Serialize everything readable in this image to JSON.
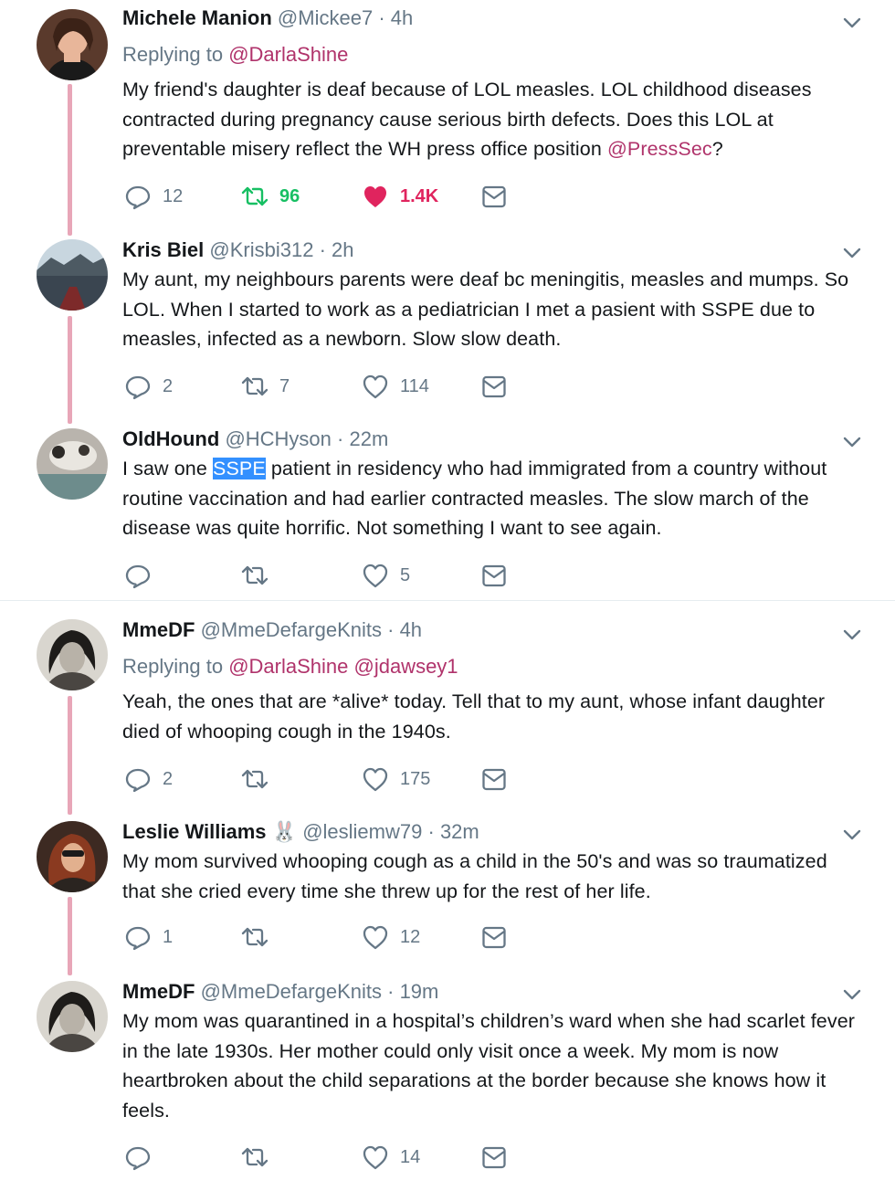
{
  "colors": {
    "mention": "#b0336b",
    "thread_line": "#e8a6b8",
    "retweet_active": "#17bf63",
    "like_active": "#e0245e",
    "secondary": "#657786"
  },
  "threads": [
    {
      "tweets": [
        {
          "name": "Michele Manion",
          "handle": "@Mickee7",
          "time": "4h",
          "replying_label": "Replying to",
          "replying_to": "@DarlaShine",
          "text": "My friend's daughter is deaf because of LOL measles. LOL childhood diseases contracted during pregnancy cause serious birth defects. Does this LOL at preventable misery reflect the WH press office position ",
          "text_mention": "@PressSec",
          "text_end": "?",
          "replies": "12",
          "retweets": "96",
          "likes": "1.4K",
          "retweeted": true,
          "liked": true
        },
        {
          "name": "Kris Biel",
          "handle": "@Krisbi312",
          "time": "2h",
          "text": "My aunt, my neighbours parents were deaf bc meningitis, measles and mumps. So LOL. When I started to work as a pediatrician I met a pasient with SSPE due to measles, infected as a newborn. Slow slow death.",
          "replies": "2",
          "retweets": "7",
          "likes": "114"
        },
        {
          "name": "OldHound",
          "handle": "@HCHyson",
          "time": "22m",
          "text_before": "I saw one ",
          "text_highlight": "SSPE",
          "text_after": " patient in residency who had immigrated from a country without routine vaccination and had earlier contracted measles. The slow march of the disease was quite horrific. Not something I want to see again.",
          "replies": "",
          "retweets": "",
          "likes": "5"
        }
      ]
    },
    {
      "tweets": [
        {
          "name": "MmeDF",
          "handle": "@MmeDefargeKnits",
          "time": "4h",
          "replying_label": "Replying to",
          "replying_to": "@DarlaShine @jdawsey1",
          "text": "Yeah, the ones that are *alive* today. Tell that to my aunt, whose infant daughter died of whooping cough in the 1940s.",
          "replies": "2",
          "retweets": "",
          "likes": "175"
        },
        {
          "name": "Leslie Williams",
          "name_emoji": "🐰",
          "handle": "@lesliemw79",
          "time": "32m",
          "text": "My mom survived whooping cough as a child in the 50's and was so traumatized that she cried every time she threw up for the rest of her life.",
          "replies": "1",
          "retweets": "",
          "likes": "12"
        },
        {
          "name": "MmeDF",
          "handle": "@MmeDefargeKnits",
          "time": "19m",
          "text": "My mom was quarantined in a hospital’s children’s ward when she had scarlet fever in the late 1930s. Her mother could only visit once a week. My mom is now heartbroken about the child separations at the border because she knows how it feels.",
          "replies": "",
          "retweets": "",
          "likes": "14"
        }
      ]
    }
  ]
}
